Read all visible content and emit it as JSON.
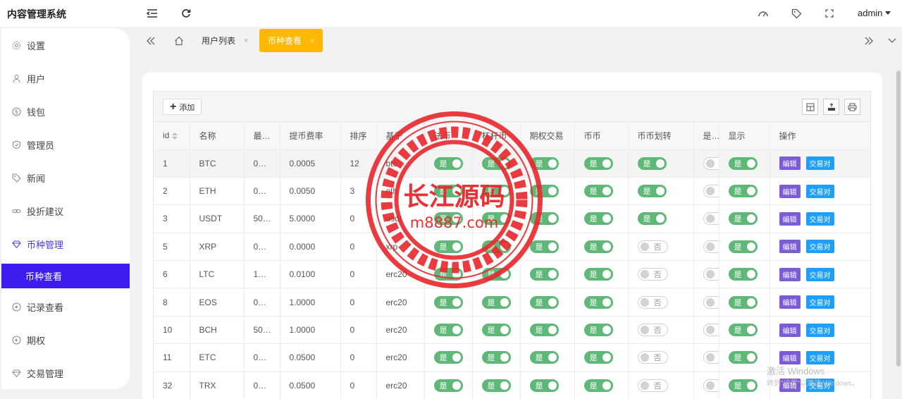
{
  "app": {
    "title": "内容管理系统"
  },
  "topbar": {
    "user": "admin"
  },
  "sidebar": {
    "items": [
      {
        "label": "设置",
        "icon": "gear-icon"
      },
      {
        "label": "用户",
        "icon": "user-icon"
      },
      {
        "label": "钱包",
        "icon": "wallet-icon"
      },
      {
        "label": "管理员",
        "icon": "shield-icon"
      },
      {
        "label": "新闻",
        "icon": "tag-icon"
      },
      {
        "label": "投折建议",
        "icon": "link-icon"
      },
      {
        "label": "币种管理",
        "icon": "diamond-icon"
      },
      {
        "label": "记录查看",
        "icon": "record-icon"
      },
      {
        "label": "期权",
        "icon": "record-icon"
      },
      {
        "label": "交易管理",
        "icon": "diamond-icon"
      }
    ],
    "active_sub": "币种查看"
  },
  "tabs": [
    {
      "label": "用户列表",
      "close": "×"
    },
    {
      "label": "币种查看",
      "close": "×"
    }
  ],
  "toolbar": {
    "add_label": "添加"
  },
  "table": {
    "headers": [
      "id",
      "名称",
      "最…",
      "提币费率",
      "排序",
      "基于",
      "法币",
      "杠杆币",
      "期权交易",
      "币币",
      "币币划转",
      "是…",
      "显示",
      "操作"
    ],
    "on_label": "是",
    "off_label": "否",
    "edit_label": "编辑",
    "pair_label": "交易对",
    "rows": [
      {
        "id": "1",
        "name": "BTC",
        "min": "0…",
        "fee": "0.0005",
        "sort": "12",
        "base": "btc",
        "transfer": "on"
      },
      {
        "id": "2",
        "name": "ETH",
        "min": "0…",
        "fee": "0.0050",
        "sort": "3",
        "base": "eth",
        "transfer": "on"
      },
      {
        "id": "3",
        "name": "USDT",
        "min": "50…",
        "fee": "5.0000",
        "sort": "0",
        "base": "usdt",
        "transfer": "on"
      },
      {
        "id": "5",
        "name": "XRP",
        "min": "0…",
        "fee": "0.0000",
        "sort": "0",
        "base": "xrp",
        "transfer": "off"
      },
      {
        "id": "6",
        "name": "LTC",
        "min": "1…",
        "fee": "0.0100",
        "sort": "0",
        "base": "erc20",
        "transfer": "off"
      },
      {
        "id": "8",
        "name": "EOS",
        "min": "0…",
        "fee": "1.0000",
        "sort": "0",
        "base": "erc20",
        "transfer": "off"
      },
      {
        "id": "10",
        "name": "BCH",
        "min": "50…",
        "fee": "1.0000",
        "sort": "0",
        "base": "erc20",
        "transfer": "off"
      },
      {
        "id": "11",
        "name": "ETC",
        "min": "0…",
        "fee": "0.0500",
        "sort": "0",
        "base": "erc20",
        "transfer": "off"
      },
      {
        "id": "32",
        "name": "TRX",
        "min": "0…",
        "fee": "0.0500",
        "sort": "0",
        "base": "erc20",
        "transfer": "off"
      }
    ]
  },
  "watermark": {
    "stamp_text": "长江源码",
    "stamp_url": "m8887.com",
    "os_line1": "激活 Windows",
    "os_line2": "转到\"设置\"以激活 Windows。"
  },
  "colors": {
    "accent": "#3d1cf0",
    "tab_active": "#ffb800",
    "switch_on": "#5fb878",
    "edit_button": "#7b5bd6",
    "pair_button": "#1e9fff",
    "stamp": "#e8262b"
  }
}
